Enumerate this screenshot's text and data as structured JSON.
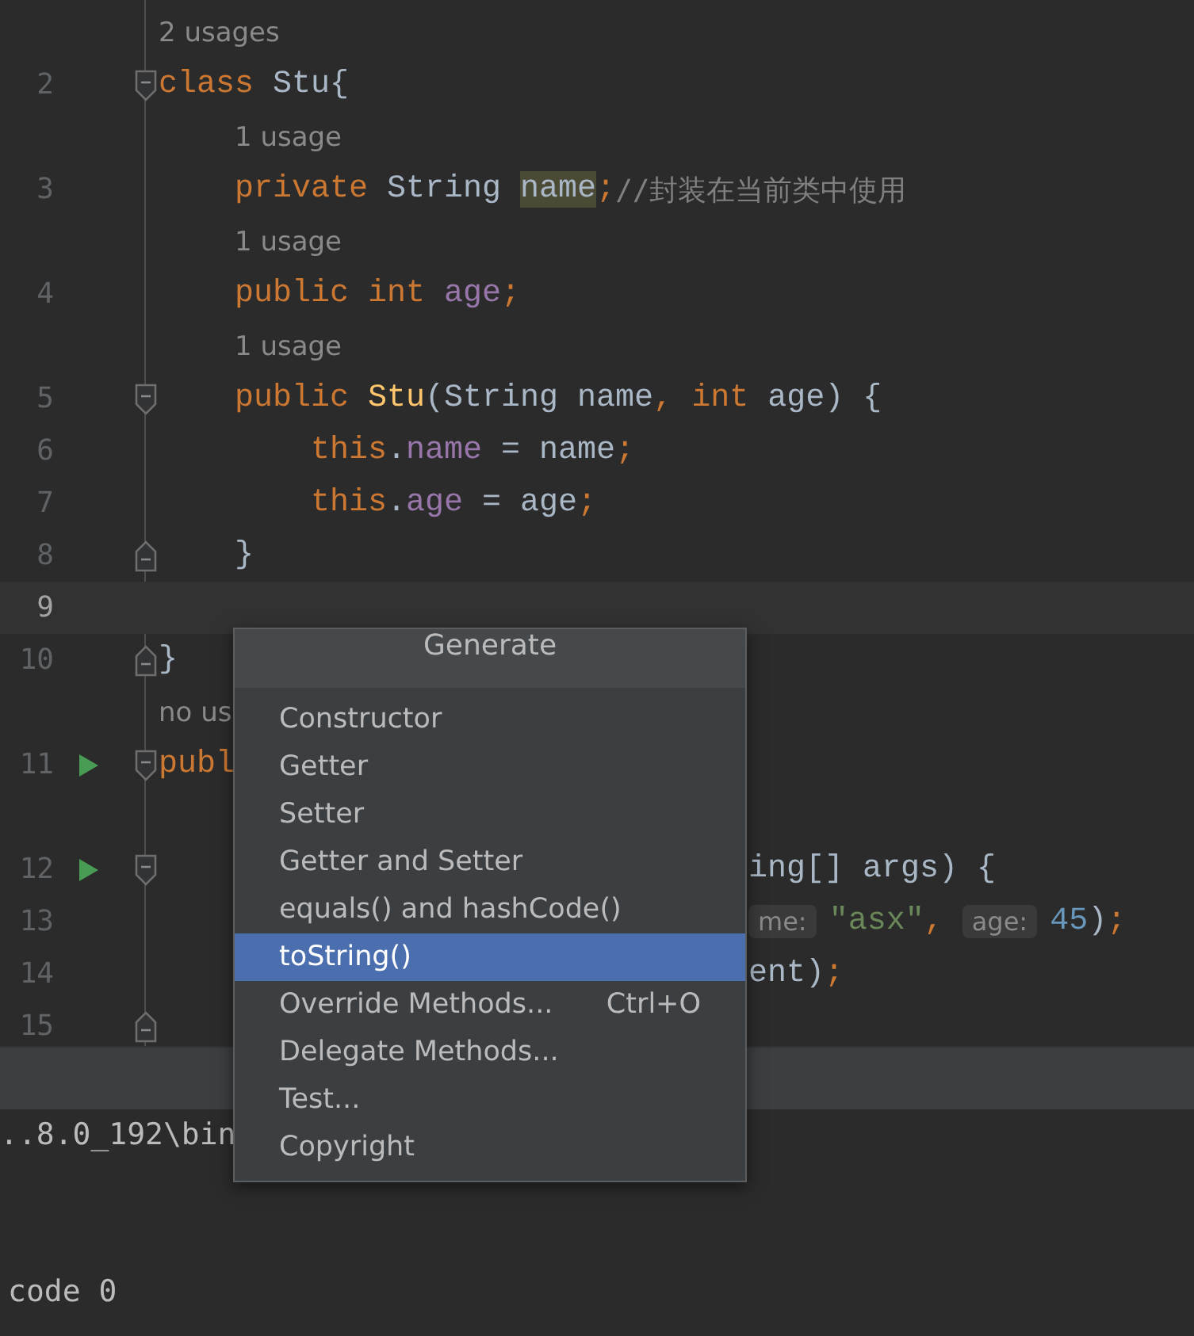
{
  "editor": {
    "rows": [
      {
        "kind": "usage",
        "text": "2 usages"
      },
      {
        "kind": "code",
        "number": "2",
        "current": false,
        "runnable": false,
        "fold_start": true,
        "fold_end": false,
        "segments": [
          {
            "kind": "keyword",
            "text": "class "
          },
          {
            "kind": "plain",
            "text": "Stu{"
          }
        ]
      },
      {
        "kind": "usage",
        "text": "1 usage"
      },
      {
        "kind": "code",
        "number": "3",
        "current": false,
        "runnable": false,
        "fold_start": false,
        "fold_end": false,
        "segments": [
          {
            "kind": "keyword",
            "text": "private "
          },
          {
            "kind": "plain",
            "text": "String "
          },
          {
            "kind": "match",
            "text": "name"
          },
          {
            "kind": "keyword",
            "text": ";"
          },
          {
            "kind": "comment",
            "text": "//封装在当前类中使用"
          }
        ]
      },
      {
        "kind": "usage",
        "text": "1 usage"
      },
      {
        "kind": "code",
        "number": "4",
        "current": false,
        "runnable": false,
        "fold_start": false,
        "fold_end": false,
        "segments": [
          {
            "kind": "keyword",
            "text": "public int "
          },
          {
            "kind": "field",
            "text": "age"
          },
          {
            "kind": "keyword",
            "text": ";"
          }
        ]
      },
      {
        "kind": "usage",
        "text": "1 usage"
      },
      {
        "kind": "code",
        "number": "5",
        "current": false,
        "runnable": false,
        "fold_start": true,
        "fold_end": false,
        "segments": [
          {
            "kind": "keyword",
            "text": "public "
          },
          {
            "kind": "method",
            "text": "Stu"
          },
          {
            "kind": "plain",
            "text": "(String name"
          },
          {
            "kind": "keyword",
            "text": ", int "
          },
          {
            "kind": "plain",
            "text": "age) {"
          }
        ]
      },
      {
        "kind": "code",
        "number": "6",
        "current": false,
        "runnable": false,
        "fold_start": false,
        "fold_end": false,
        "segments": [
          {
            "kind": "keyword",
            "text": "this"
          },
          {
            "kind": "plain",
            "text": "."
          },
          {
            "kind": "field",
            "text": "name"
          },
          {
            "kind": "plain",
            "text": " = name"
          },
          {
            "kind": "keyword",
            "text": ";"
          }
        ]
      },
      {
        "kind": "code",
        "number": "7",
        "current": false,
        "runnable": false,
        "fold_start": false,
        "fold_end": false,
        "segments": [
          {
            "kind": "keyword",
            "text": "this"
          },
          {
            "kind": "plain",
            "text": "."
          },
          {
            "kind": "field",
            "text": "age"
          },
          {
            "kind": "plain",
            "text": " = age"
          },
          {
            "kind": "keyword",
            "text": ";"
          }
        ]
      },
      {
        "kind": "code",
        "number": "8",
        "current": false,
        "runnable": false,
        "fold_start": false,
        "fold_end": true,
        "segments": [
          {
            "kind": "plain",
            "text": "}"
          }
        ]
      },
      {
        "kind": "code",
        "number": "9",
        "current": true,
        "runnable": false,
        "fold_start": false,
        "fold_end": false,
        "segments": []
      },
      {
        "kind": "code",
        "number": "10",
        "current": false,
        "runnable": false,
        "fold_start": false,
        "fold_end": true,
        "segments": [
          {
            "kind": "plain",
            "text": "}"
          }
        ]
      },
      {
        "kind": "usage",
        "text": "no us"
      },
      {
        "kind": "code",
        "number": "11",
        "current": false,
        "runnable": true,
        "fold_start": true,
        "fold_end": false,
        "segments": [
          {
            "kind": "keyword",
            "text": "publ"
          }
        ]
      },
      {
        "kind": "blank"
      },
      {
        "kind": "code",
        "number": "12",
        "current": false,
        "runnable": true,
        "fold_start": true,
        "fold_end": false,
        "segments": [
          {
            "kind": "plain",
            "text": "ing[] args) {"
          }
        ]
      },
      {
        "kind": "code",
        "number": "13",
        "current": false,
        "runnable": false,
        "fold_start": false,
        "fold_end": false,
        "segments": [
          {
            "kind": "hint",
            "text": "me:"
          },
          {
            "kind": "string",
            "text": "\"asx\""
          },
          {
            "kind": "keyword",
            "text": ", "
          },
          {
            "kind": "hint",
            "text": "age:"
          },
          {
            "kind": "number",
            "text": "45"
          },
          {
            "kind": "plain",
            "text": ")"
          },
          {
            "kind": "keyword",
            "text": ";"
          }
        ]
      },
      {
        "kind": "code",
        "number": "14",
        "current": false,
        "runnable": false,
        "fold_start": false,
        "fold_end": false,
        "segments": [
          {
            "kind": "plain",
            "text": "ent)"
          },
          {
            "kind": "keyword",
            "text": ";"
          }
        ]
      },
      {
        "kind": "code",
        "number": "15",
        "current": false,
        "runnable": false,
        "fold_start": false,
        "fold_end": true,
        "segments": []
      }
    ]
  },
  "console": {
    "lines": [
      "..8.0_192\\bin",
      "code 0"
    ]
  },
  "generate_menu": {
    "title": "Generate",
    "items": [
      {
        "label": "Constructor",
        "selected": false
      },
      {
        "label": "Getter",
        "selected": false
      },
      {
        "label": "Setter",
        "selected": false
      },
      {
        "label": "Getter and Setter",
        "selected": false
      },
      {
        "label": "equals() and hashCode()",
        "selected": false
      },
      {
        "label": "toString()",
        "selected": true
      },
      {
        "label": "Override Methods...",
        "shortcut": "Ctrl+O",
        "selected": false
      },
      {
        "label": "Delegate Methods...",
        "selected": false
      },
      {
        "label": "Test...",
        "selected": false
      },
      {
        "label": "Copyright",
        "selected": false
      }
    ]
  }
}
